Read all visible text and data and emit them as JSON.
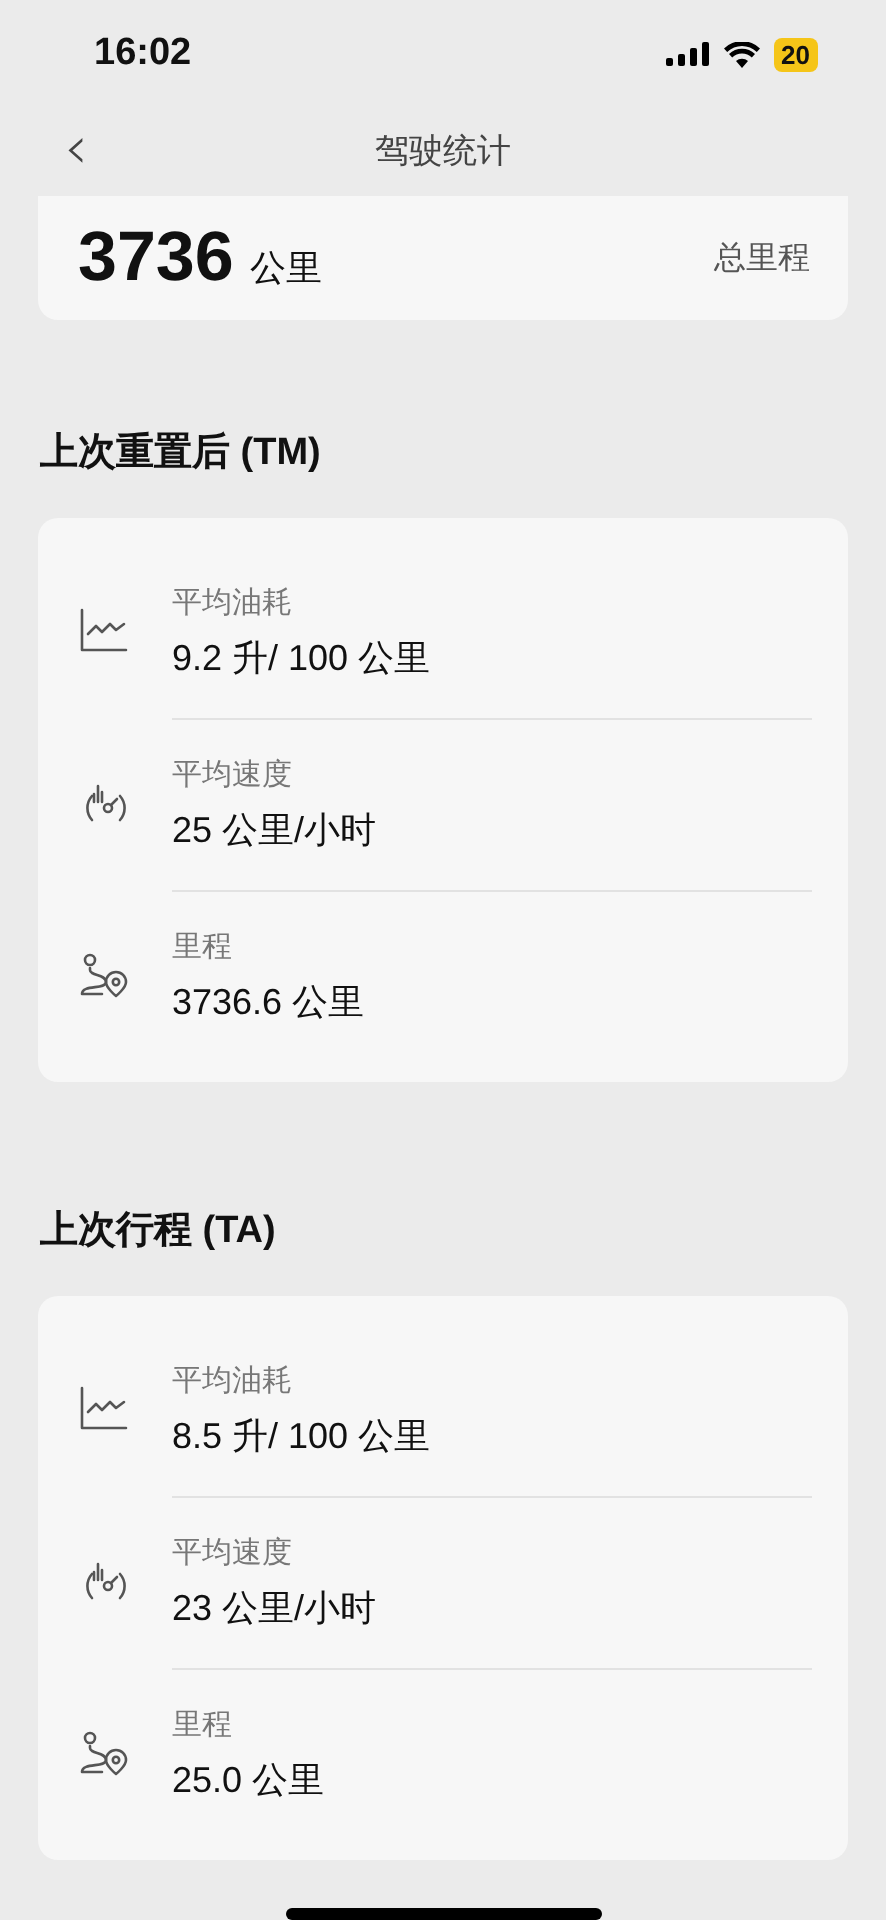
{
  "status_bar": {
    "time": "16:02",
    "battery": "20"
  },
  "nav": {
    "back": "‹",
    "title": "驾驶统计"
  },
  "total": {
    "value": "3736",
    "unit": "公里",
    "label": "总里程"
  },
  "sections": [
    {
      "title": "上次重置后 (TM)",
      "rows": [
        {
          "kind": "consumption",
          "label": "平均油耗",
          "value": "9.2 升/ 100 公里"
        },
        {
          "kind": "speed",
          "label": "平均速度",
          "value": "25 公里/小时"
        },
        {
          "kind": "distance",
          "label": "里程",
          "value": "3736.6 公里"
        }
      ]
    },
    {
      "title": "上次行程 (TA)",
      "rows": [
        {
          "kind": "consumption",
          "label": "平均油耗",
          "value": "8.5 升/ 100 公里"
        },
        {
          "kind": "speed",
          "label": "平均速度",
          "value": "23 公里/小时"
        },
        {
          "kind": "distance",
          "label": "里程",
          "value": "25.0 公里"
        }
      ]
    }
  ]
}
